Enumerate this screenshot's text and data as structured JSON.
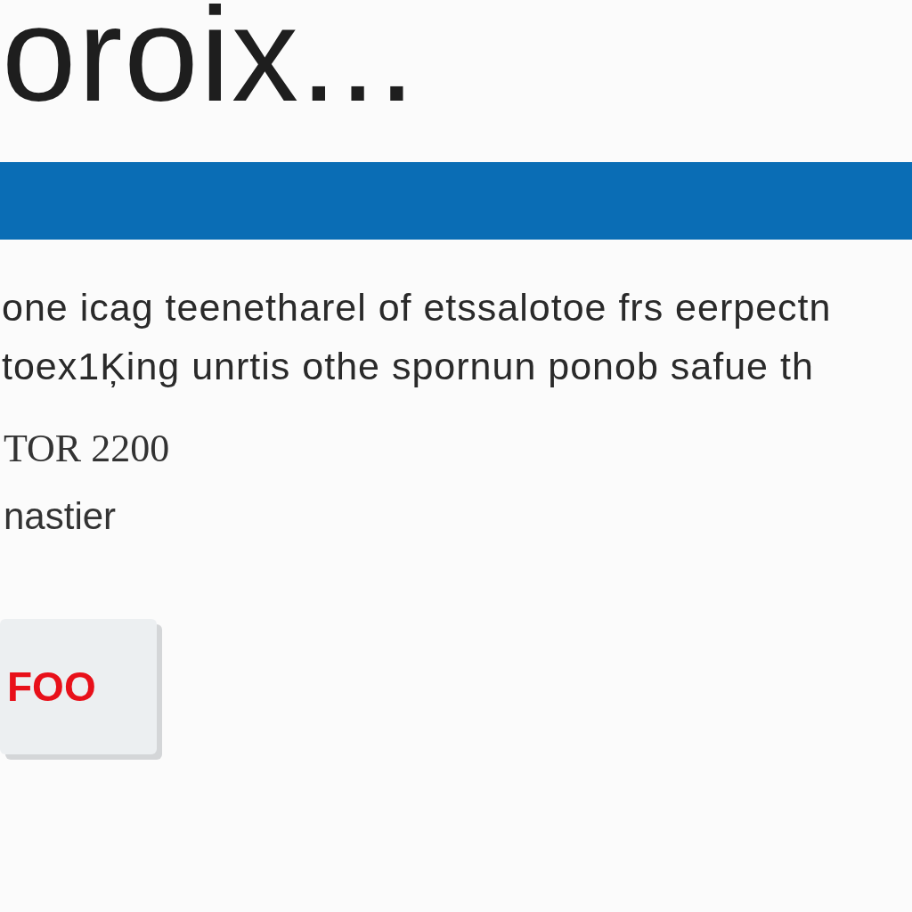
{
  "header": {
    "title": "oroix..."
  },
  "banner": {
    "kind": "bar"
  },
  "paragraph": [
    "one icag teenetharel of etssalotoe frs eerpectn",
    "toex1Ķing unrtis othe spornun ponob safue th"
  ],
  "code": "TOR 2200",
  "word": "nastier",
  "button": {
    "label": "FOO"
  }
}
